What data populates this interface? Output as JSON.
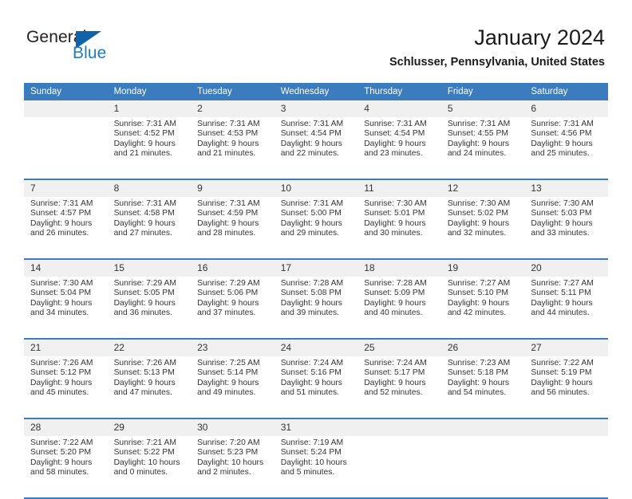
{
  "brand": {
    "name_part1": "General",
    "name_part2": "Blue",
    "accent_color": "#1d7cc4",
    "triangle_color": "#1063ab"
  },
  "header": {
    "title": "January 2024",
    "subtitle": "Schlusser, Pennsylvania, United States"
  },
  "calendar": {
    "header_bg": "#3b7cbe",
    "daynum_bg": "#f0f0f0",
    "weekdays": [
      "Sunday",
      "Monday",
      "Tuesday",
      "Wednesday",
      "Thursday",
      "Friday",
      "Saturday"
    ],
    "weeks": [
      {
        "days": [
          {
            "num": "",
            "sunrise": "",
            "sunset": "",
            "daylight_line1": "",
            "daylight_line2": ""
          },
          {
            "num": "1",
            "sunrise": "Sunrise: 7:31 AM",
            "sunset": "Sunset: 4:52 PM",
            "daylight_line1": "Daylight: 9 hours",
            "daylight_line2": "and 21 minutes."
          },
          {
            "num": "2",
            "sunrise": "Sunrise: 7:31 AM",
            "sunset": "Sunset: 4:53 PM",
            "daylight_line1": "Daylight: 9 hours",
            "daylight_line2": "and 21 minutes."
          },
          {
            "num": "3",
            "sunrise": "Sunrise: 7:31 AM",
            "sunset": "Sunset: 4:54 PM",
            "daylight_line1": "Daylight: 9 hours",
            "daylight_line2": "and 22 minutes."
          },
          {
            "num": "4",
            "sunrise": "Sunrise: 7:31 AM",
            "sunset": "Sunset: 4:54 PM",
            "daylight_line1": "Daylight: 9 hours",
            "daylight_line2": "and 23 minutes."
          },
          {
            "num": "5",
            "sunrise": "Sunrise: 7:31 AM",
            "sunset": "Sunset: 4:55 PM",
            "daylight_line1": "Daylight: 9 hours",
            "daylight_line2": "and 24 minutes."
          },
          {
            "num": "6",
            "sunrise": "Sunrise: 7:31 AM",
            "sunset": "Sunset: 4:56 PM",
            "daylight_line1": "Daylight: 9 hours",
            "daylight_line2": "and 25 minutes."
          }
        ]
      },
      {
        "days": [
          {
            "num": "7",
            "sunrise": "Sunrise: 7:31 AM",
            "sunset": "Sunset: 4:57 PM",
            "daylight_line1": "Daylight: 9 hours",
            "daylight_line2": "and 26 minutes."
          },
          {
            "num": "8",
            "sunrise": "Sunrise: 7:31 AM",
            "sunset": "Sunset: 4:58 PM",
            "daylight_line1": "Daylight: 9 hours",
            "daylight_line2": "and 27 minutes."
          },
          {
            "num": "9",
            "sunrise": "Sunrise: 7:31 AM",
            "sunset": "Sunset: 4:59 PM",
            "daylight_line1": "Daylight: 9 hours",
            "daylight_line2": "and 28 minutes."
          },
          {
            "num": "10",
            "sunrise": "Sunrise: 7:31 AM",
            "sunset": "Sunset: 5:00 PM",
            "daylight_line1": "Daylight: 9 hours",
            "daylight_line2": "and 29 minutes."
          },
          {
            "num": "11",
            "sunrise": "Sunrise: 7:30 AM",
            "sunset": "Sunset: 5:01 PM",
            "daylight_line1": "Daylight: 9 hours",
            "daylight_line2": "and 30 minutes."
          },
          {
            "num": "12",
            "sunrise": "Sunrise: 7:30 AM",
            "sunset": "Sunset: 5:02 PM",
            "daylight_line1": "Daylight: 9 hours",
            "daylight_line2": "and 32 minutes."
          },
          {
            "num": "13",
            "sunrise": "Sunrise: 7:30 AM",
            "sunset": "Sunset: 5:03 PM",
            "daylight_line1": "Daylight: 9 hours",
            "daylight_line2": "and 33 minutes."
          }
        ]
      },
      {
        "days": [
          {
            "num": "14",
            "sunrise": "Sunrise: 7:30 AM",
            "sunset": "Sunset: 5:04 PM",
            "daylight_line1": "Daylight: 9 hours",
            "daylight_line2": "and 34 minutes."
          },
          {
            "num": "15",
            "sunrise": "Sunrise: 7:29 AM",
            "sunset": "Sunset: 5:05 PM",
            "daylight_line1": "Daylight: 9 hours",
            "daylight_line2": "and 36 minutes."
          },
          {
            "num": "16",
            "sunrise": "Sunrise: 7:29 AM",
            "sunset": "Sunset: 5:06 PM",
            "daylight_line1": "Daylight: 9 hours",
            "daylight_line2": "and 37 minutes."
          },
          {
            "num": "17",
            "sunrise": "Sunrise: 7:28 AM",
            "sunset": "Sunset: 5:08 PM",
            "daylight_line1": "Daylight: 9 hours",
            "daylight_line2": "and 39 minutes."
          },
          {
            "num": "18",
            "sunrise": "Sunrise: 7:28 AM",
            "sunset": "Sunset: 5:09 PM",
            "daylight_line1": "Daylight: 9 hours",
            "daylight_line2": "and 40 minutes."
          },
          {
            "num": "19",
            "sunrise": "Sunrise: 7:27 AM",
            "sunset": "Sunset: 5:10 PM",
            "daylight_line1": "Daylight: 9 hours",
            "daylight_line2": "and 42 minutes."
          },
          {
            "num": "20",
            "sunrise": "Sunrise: 7:27 AM",
            "sunset": "Sunset: 5:11 PM",
            "daylight_line1": "Daylight: 9 hours",
            "daylight_line2": "and 44 minutes."
          }
        ]
      },
      {
        "days": [
          {
            "num": "21",
            "sunrise": "Sunrise: 7:26 AM",
            "sunset": "Sunset: 5:12 PM",
            "daylight_line1": "Daylight: 9 hours",
            "daylight_line2": "and 45 minutes."
          },
          {
            "num": "22",
            "sunrise": "Sunrise: 7:26 AM",
            "sunset": "Sunset: 5:13 PM",
            "daylight_line1": "Daylight: 9 hours",
            "daylight_line2": "and 47 minutes."
          },
          {
            "num": "23",
            "sunrise": "Sunrise: 7:25 AM",
            "sunset": "Sunset: 5:14 PM",
            "daylight_line1": "Daylight: 9 hours",
            "daylight_line2": "and 49 minutes."
          },
          {
            "num": "24",
            "sunrise": "Sunrise: 7:24 AM",
            "sunset": "Sunset: 5:16 PM",
            "daylight_line1": "Daylight: 9 hours",
            "daylight_line2": "and 51 minutes."
          },
          {
            "num": "25",
            "sunrise": "Sunrise: 7:24 AM",
            "sunset": "Sunset: 5:17 PM",
            "daylight_line1": "Daylight: 9 hours",
            "daylight_line2": "and 52 minutes."
          },
          {
            "num": "26",
            "sunrise": "Sunrise: 7:23 AM",
            "sunset": "Sunset: 5:18 PM",
            "daylight_line1": "Daylight: 9 hours",
            "daylight_line2": "and 54 minutes."
          },
          {
            "num": "27",
            "sunrise": "Sunrise: 7:22 AM",
            "sunset": "Sunset: 5:19 PM",
            "daylight_line1": "Daylight: 9 hours",
            "daylight_line2": "and 56 minutes."
          }
        ]
      },
      {
        "days": [
          {
            "num": "28",
            "sunrise": "Sunrise: 7:22 AM",
            "sunset": "Sunset: 5:20 PM",
            "daylight_line1": "Daylight: 9 hours",
            "daylight_line2": "and 58 minutes."
          },
          {
            "num": "29",
            "sunrise": "Sunrise: 7:21 AM",
            "sunset": "Sunset: 5:22 PM",
            "daylight_line1": "Daylight: 10 hours",
            "daylight_line2": "and 0 minutes."
          },
          {
            "num": "30",
            "sunrise": "Sunrise: 7:20 AM",
            "sunset": "Sunset: 5:23 PM",
            "daylight_line1": "Daylight: 10 hours",
            "daylight_line2": "and 2 minutes."
          },
          {
            "num": "31",
            "sunrise": "Sunrise: 7:19 AM",
            "sunset": "Sunset: 5:24 PM",
            "daylight_line1": "Daylight: 10 hours",
            "daylight_line2": "and 5 minutes."
          },
          {
            "num": "",
            "sunrise": "",
            "sunset": "",
            "daylight_line1": "",
            "daylight_line2": ""
          },
          {
            "num": "",
            "sunrise": "",
            "sunset": "",
            "daylight_line1": "",
            "daylight_line2": ""
          },
          {
            "num": "",
            "sunrise": "",
            "sunset": "",
            "daylight_line1": "",
            "daylight_line2": ""
          }
        ]
      }
    ]
  }
}
